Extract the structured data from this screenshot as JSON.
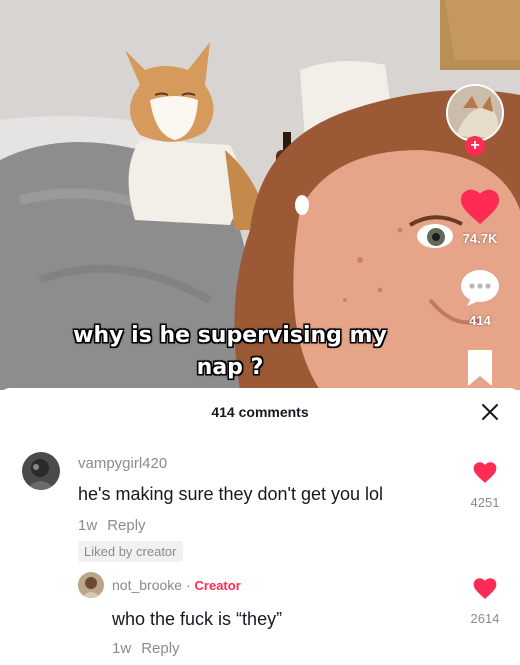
{
  "video": {
    "caption_line1": "why is he supervising my",
    "caption_line2": "nap ?",
    "likes": "74.7K",
    "comment_count": "414",
    "accent_color": "#fe2c55"
  },
  "comments_sheet": {
    "title": "414 comments",
    "comments": [
      {
        "username": "vampygirl420",
        "text": "he's making sure they don't get you lol",
        "age": "1w",
        "reply_label": "Reply",
        "badge": "Liked by creator",
        "likes": "4251"
      },
      {
        "username": "not_brooke",
        "separator": " · ",
        "creator_label": "Creator",
        "text": "who the fuck is “they”",
        "age": "1w",
        "reply_label": "Reply",
        "likes": "2614"
      }
    ]
  },
  "icons": [
    "plus-icon",
    "heart-icon",
    "comment-bubble-icon",
    "bookmark-icon",
    "close-icon",
    "heart-icon"
  ]
}
